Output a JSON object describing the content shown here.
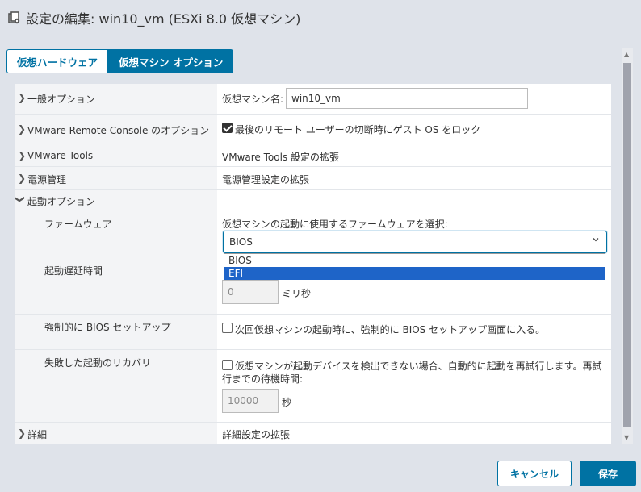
{
  "dialog": {
    "title": "設定の編集: win10_vm (ESXi 8.0 仮想マシン)",
    "icon": "vm-settings-icon"
  },
  "tabs": [
    {
      "label": "仮想ハードウェア",
      "active": false
    },
    {
      "label": "仮想マシン オプション",
      "active": true
    }
  ],
  "sections": {
    "general": {
      "label": "一般オプション",
      "vm_name_label": "仮想マシン名:",
      "vm_name_value": "win10_vm"
    },
    "vmrc": {
      "label": "VMware Remote Console のオプション",
      "lock_text": "最後のリモート ユーザーの切断時にゲスト OS をロック",
      "lock_checked": true
    },
    "tools": {
      "label": "VMware Tools",
      "value": "VMware Tools 設定の拡張"
    },
    "power": {
      "label": "電源管理",
      "value": "電源管理設定の拡張"
    },
    "boot": {
      "label": "起動オプション",
      "firmware_label": "ファームウェア",
      "firmware_prompt": "仮想マシンの起動に使用するファームウェアを選択:",
      "firmware_selected": "BIOS",
      "firmware_options": [
        "BIOS",
        "EFI"
      ],
      "highlighted_option": "EFI",
      "delay_label": "起動遅延時間",
      "delay_value": "0",
      "delay_unit": "ミリ秒",
      "force_bios_label": "強制的に BIOS セットアップ",
      "force_bios_text": "次回仮想マシンの起動時に、強制的に BIOS セットアップ画面に入る。",
      "force_bios_checked": false,
      "recovery_label": "失敗した起動のリカバリ",
      "recovery_text_line1": "仮想マシンが起動デバイスを検出できない場合、自動的に起動を再試行します。再試",
      "recovery_text_line2": "行までの待機時間:",
      "recovery_checked": false,
      "recovery_value": "10000",
      "recovery_unit": "秒"
    },
    "advanced": {
      "label": "詳細",
      "value": "詳細設定の拡張"
    }
  },
  "buttons": {
    "cancel": "キャンセル",
    "save": "保存"
  },
  "colors": {
    "accent": "#0072a3",
    "highlight": "#1e64c8"
  }
}
